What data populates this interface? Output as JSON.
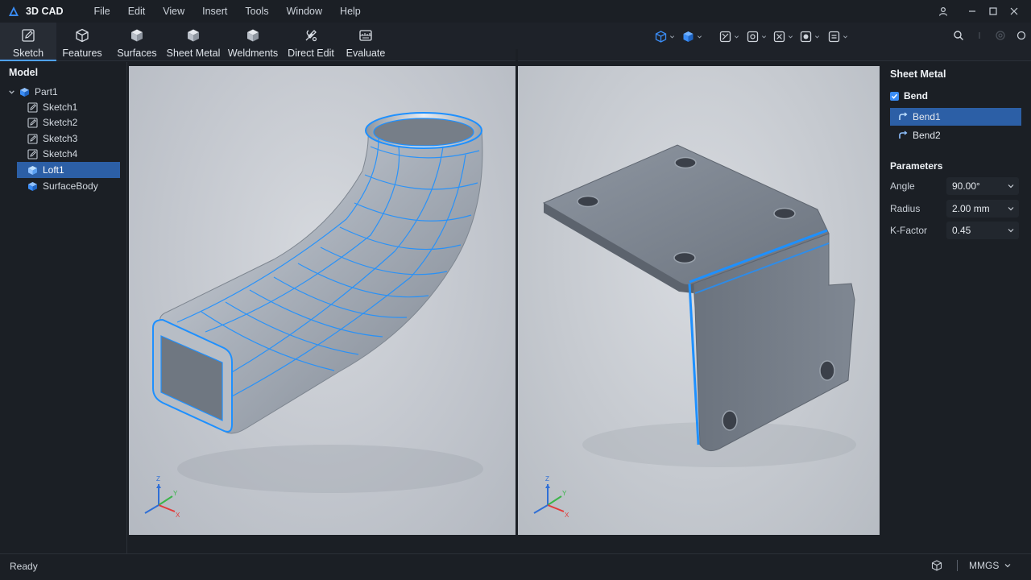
{
  "app": {
    "title": "3D CAD"
  },
  "menu": [
    "File",
    "Edit",
    "View",
    "Insert",
    "Tools",
    "Window",
    "Help"
  ],
  "ribbon": {
    "tabs": [
      {
        "label": "Sketch",
        "icon": "pencil-icon",
        "active": true
      },
      {
        "label": "Features",
        "icon": "cube-outline-icon"
      },
      {
        "label": "Surfaces",
        "icon": "cube-solid-icon"
      },
      {
        "label": "Sheet Metal",
        "icon": "cube-solid-icon"
      },
      {
        "label": "Weldments",
        "icon": "cube-solid-icon"
      },
      {
        "label": "Direct Edit",
        "icon": "tools-icon"
      },
      {
        "label": "Evaluate",
        "icon": "measure-icon"
      }
    ],
    "view_tools": [
      "view-orientation-icon",
      "display-style-icon",
      "section-view-icon",
      "hide-show-icon",
      "appearance-icon",
      "scene-icon",
      "render-icon"
    ],
    "right_tools": [
      "search-icon",
      "more-icon",
      "help-icon"
    ]
  },
  "model_tree": {
    "title": "Model",
    "root": "Part1",
    "items": [
      {
        "label": "Sketch1",
        "icon": "sketch-icon"
      },
      {
        "label": "Sketch2",
        "icon": "sketch-icon"
      },
      {
        "label": "Sketch3",
        "icon": "sketch-icon"
      },
      {
        "label": "Sketch4",
        "icon": "sketch-icon"
      },
      {
        "label": "Loft1",
        "icon": "loft-icon",
        "selected": true
      },
      {
        "label": "SurfaceBody",
        "icon": "body-icon"
      }
    ]
  },
  "viewports": [
    {
      "name": "loft-viewport",
      "triad": {
        "z": "Z",
        "y": "Y",
        "x": "X"
      }
    },
    {
      "name": "sheet-metal-viewport",
      "triad": {
        "z": "Z",
        "y": "Y",
        "x": "X"
      }
    }
  ],
  "properties": {
    "title": "Sheet Metal",
    "group": {
      "label": "Bend",
      "checked": true
    },
    "bends": [
      {
        "label": "Bend1",
        "selected": true
      },
      {
        "label": "Bend2"
      }
    ],
    "parameters_title": "Parameters",
    "parameters": [
      {
        "label": "Angle",
        "value": "90.00°"
      },
      {
        "label": "Radius",
        "value": "2.00 mm"
      },
      {
        "label": "K-Factor",
        "value": "0.45"
      }
    ]
  },
  "status": {
    "text": "Ready",
    "units": "MMGS"
  },
  "colors": {
    "accent": "#3a8cf5",
    "selection": "#2c5fa6",
    "background": "#1b1f25",
    "highlight_edge": "#1e90ff"
  }
}
